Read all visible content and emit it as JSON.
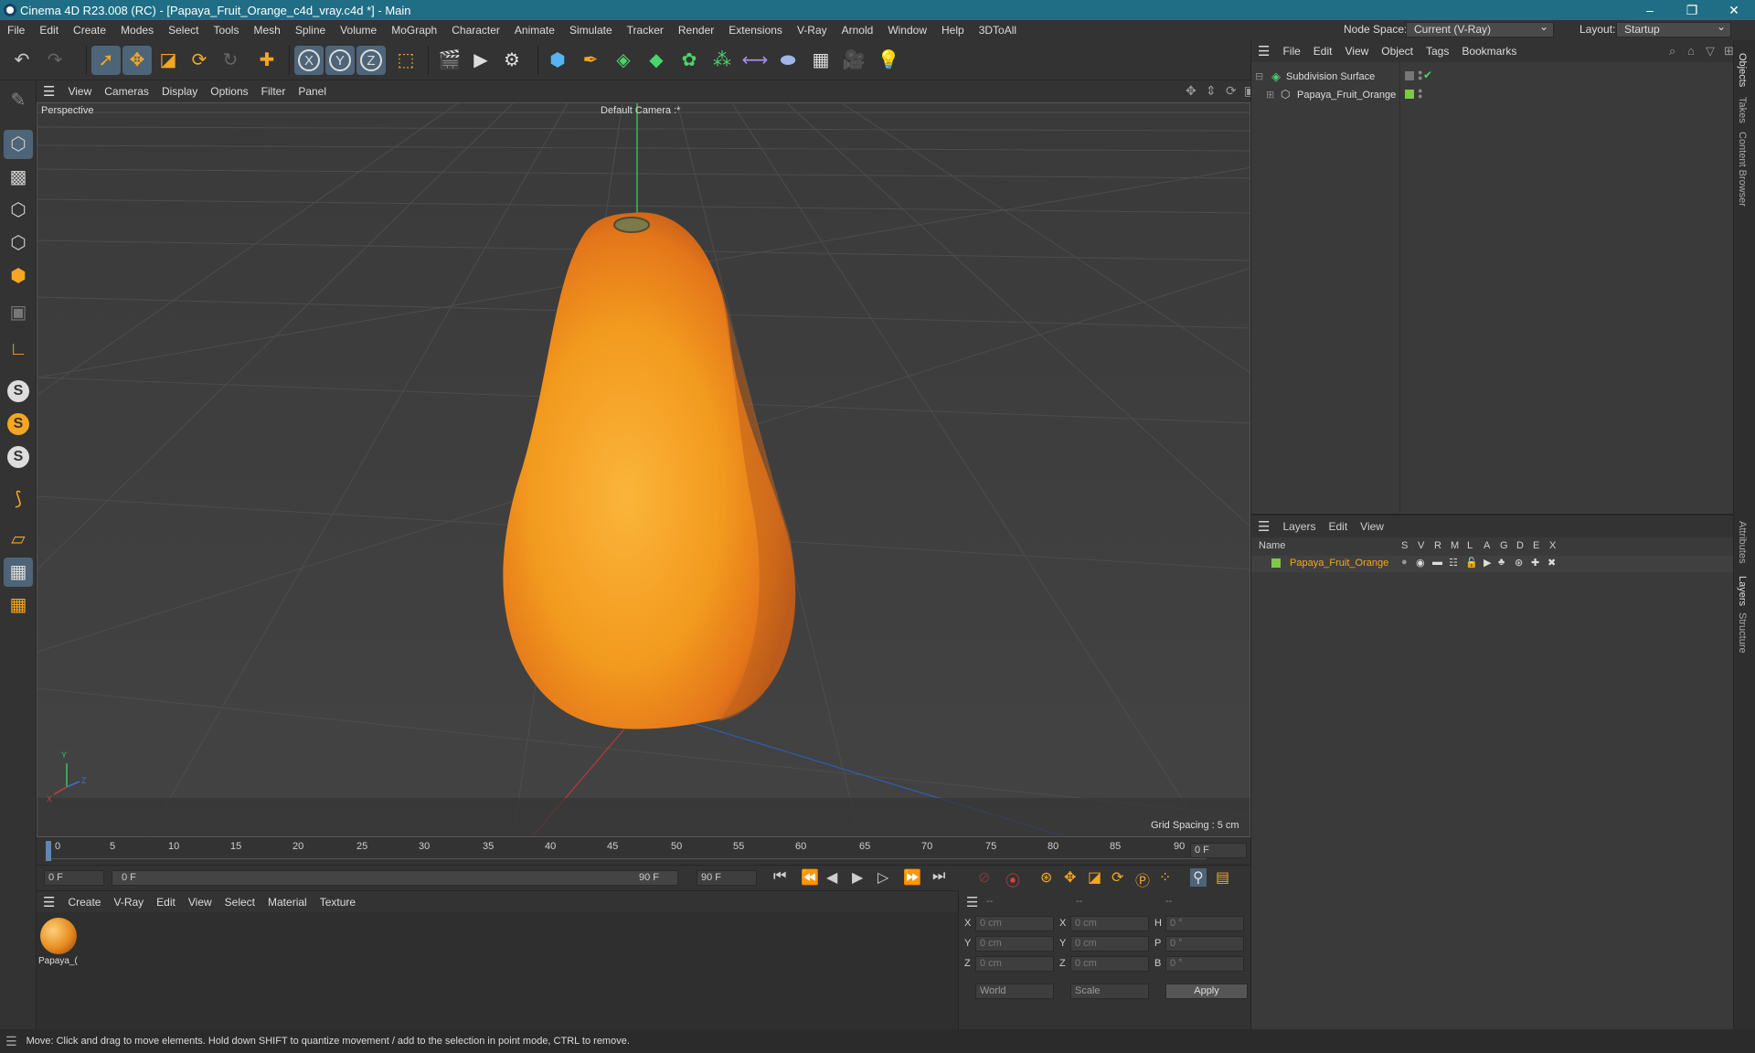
{
  "window": {
    "title": "Cinema 4D R23.008 (RC) - [Papaya_Fruit_Orange_c4d_vray.c4d *] - Main",
    "minimize": "–",
    "restore": "❐",
    "close": "✕"
  },
  "menubar": {
    "items": [
      "File",
      "Edit",
      "Create",
      "Modes",
      "Select",
      "Tools",
      "Mesh",
      "Spline",
      "Volume",
      "MoGraph",
      "Character",
      "Animate",
      "Simulate",
      "Tracker",
      "Render",
      "Extensions",
      "V-Ray",
      "Arnold",
      "Window",
      "Help",
      "3DToAll"
    ],
    "node_space_label": "Node Space:",
    "node_space_value": "Current (V-Ray)",
    "layout_label": "Layout:",
    "layout_value": "Startup"
  },
  "toolbar": {
    "axis_x": "X",
    "axis_y": "Y",
    "axis_z": "Z"
  },
  "viewport": {
    "menu": [
      "View",
      "Cameras",
      "Display",
      "Options",
      "Filter",
      "Panel"
    ],
    "view_name": "Perspective",
    "camera_name": "Default Camera :*",
    "grid_spacing": "Grid Spacing : 5 cm",
    "axis_x": "X",
    "axis_y": "Y",
    "axis_z": "Z"
  },
  "timeline": {
    "ticks": [
      "0",
      "5",
      "10",
      "15",
      "20",
      "25",
      "30",
      "35",
      "40",
      "45",
      "50",
      "55",
      "60",
      "65",
      "70",
      "75",
      "80",
      "85",
      "90"
    ],
    "current_frame_display": "0 F"
  },
  "transport": {
    "start_frame": "0 F",
    "range_start": "0 F",
    "range_end": "90 F",
    "end_frame": "90 F"
  },
  "material_manager": {
    "menu": [
      "Create",
      "V-Ray",
      "Edit",
      "View",
      "Select",
      "Material",
      "Texture"
    ],
    "materials": [
      {
        "name": "Papaya_("
      }
    ]
  },
  "coordinates": {
    "header": [
      "--",
      "--",
      "--"
    ],
    "rows": [
      {
        "a_label": "X",
        "a_value": "0 cm",
        "b_label": "X",
        "b_value": "0 cm",
        "c_label": "H",
        "c_value": "0 °"
      },
      {
        "a_label": "Y",
        "a_value": "0 cm",
        "b_label": "Y",
        "b_value": "0 cm",
        "c_label": "P",
        "c_value": "0 °"
      },
      {
        "a_label": "Z",
        "a_value": "0 cm",
        "b_label": "Z",
        "b_value": "0 cm",
        "c_label": "B",
        "c_value": "0 °"
      }
    ],
    "space": "World",
    "mode": "Scale",
    "apply": "Apply"
  },
  "object_manager": {
    "menu": [
      "File",
      "Edit",
      "View",
      "Object",
      "Tags",
      "Bookmarks"
    ],
    "objects": [
      {
        "name": "Subdivision Surface"
      },
      {
        "name": "Papaya_Fruit_Orange"
      }
    ]
  },
  "layer_manager": {
    "menu": [
      "Layers",
      "Edit",
      "View"
    ],
    "columns": [
      "Name",
      "S",
      "V",
      "R",
      "M",
      "L",
      "A",
      "G",
      "D",
      "E",
      "X"
    ],
    "layers": [
      {
        "name": "Papaya_Fruit_Orange",
        "color": "#7ec84a"
      }
    ]
  },
  "side_tabs": {
    "top": [
      "Objects",
      "Takes",
      "Content Browser"
    ],
    "bottom": [
      "Attributes",
      "Layers",
      "Structure"
    ]
  },
  "status": {
    "text": "Move: Click and drag to move elements. Hold down SHIFT to quantize movement / add to the selection in point mode, CTRL to remove."
  },
  "colors": {
    "title_bar": "#1f6e86",
    "accent_orange": "#f5a623",
    "selection_blue": "#4e6478",
    "fruit": "#f2a02a"
  }
}
